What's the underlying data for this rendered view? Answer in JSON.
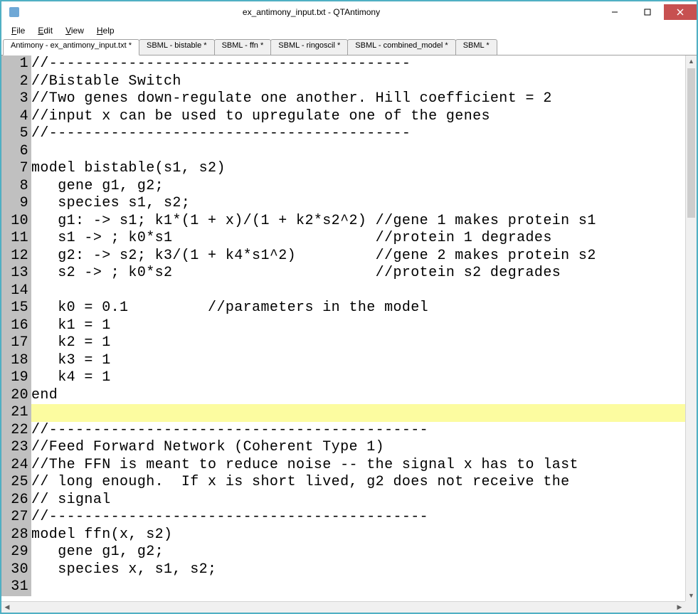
{
  "window": {
    "title": "ex_antimony_input.txt - QTAntimony",
    "controls": {
      "min": "minimize",
      "max": "maximize",
      "close": "close"
    }
  },
  "menu": {
    "file": "File",
    "edit": "Edit",
    "view": "View",
    "help": "Help"
  },
  "tabs": [
    {
      "label": "Antimony - ex_antimony_input.txt *",
      "active": true
    },
    {
      "label": "SBML - bistable *",
      "active": false
    },
    {
      "label": "SBML - ffn *",
      "active": false
    },
    {
      "label": "SBML - ringoscil *",
      "active": false
    },
    {
      "label": "SBML - combined_model *",
      "active": false
    },
    {
      "label": "SBML *",
      "active": false
    }
  ],
  "editor": {
    "highlighted_line": 21,
    "lines": [
      "//-----------------------------------------",
      "//Bistable Switch",
      "//Two genes down-regulate one another. Hill coefficient = 2",
      "//input x can be used to upregulate one of the genes",
      "//-----------------------------------------",
      "",
      "model bistable(s1, s2)",
      "   gene g1, g2;",
      "   species s1, s2;",
      "   g1: -> s1; k1*(1 + x)/(1 + k2*s2^2) //gene 1 makes protein s1",
      "   s1 -> ; k0*s1                       //protein 1 degrades",
      "   g2: -> s2; k3/(1 + k4*s1^2)         //gene 2 makes protein s2",
      "   s2 -> ; k0*s2                       //protein s2 degrades",
      "",
      "   k0 = 0.1         //parameters in the model",
      "   k1 = 1",
      "   k2 = 1",
      "   k3 = 1",
      "   k4 = 1",
      "end",
      "",
      "//-------------------------------------------",
      "//Feed Forward Network (Coherent Type 1)",
      "//The FFN is meant to reduce noise -- the signal x has to last",
      "// long enough.  If x is short lived, g2 does not receive the",
      "// signal",
      "//-------------------------------------------",
      "model ffn(x, s2)",
      "   gene g1, g2;",
      "   species x, s1, s2;",
      ""
    ]
  }
}
